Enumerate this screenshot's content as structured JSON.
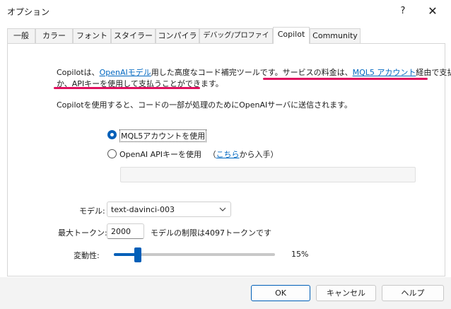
{
  "window": {
    "title": "オプション",
    "help_symbol": "?",
    "close_symbol": "✕"
  },
  "tabs": [
    {
      "label": "一般"
    },
    {
      "label": "カラー"
    },
    {
      "label": "フォント"
    },
    {
      "label": "スタイラー"
    },
    {
      "label": "コンパイラ"
    },
    {
      "label": "デバッグ/プロファイリング"
    },
    {
      "label": "Copilot",
      "active": true
    },
    {
      "label": "Community"
    }
  ],
  "intro": {
    "p1_a": "Copilotは、",
    "p1_link": "OpenAIモデル",
    "p1_b": "用した高度なコード補完ツールです。",
    "p1_c": "サービスの料金は、",
    "p1_link2": "MQL5 アカウント",
    "p1_d": "経由で支払う",
    "p1_line2": "か、APIキーを使用して支払うことができます。",
    "p2": "Copilotを使用すると、コードの一部が処理のためにOpenAIサーバに送信されます。"
  },
  "payment": {
    "option_mql5": "MQL5アカウントを使用",
    "option_api": "OpenAI APIキーを使用",
    "api_hint_open": "（",
    "api_hint_link": "こちら",
    "api_hint_rest": "から入手）",
    "selected": "mql5"
  },
  "model": {
    "label": "モデル:",
    "value": "text-davinci-003"
  },
  "max_tokens": {
    "label": "最大トークン:",
    "value": "2000",
    "note": "モデルの制限は4097トークンです"
  },
  "variability": {
    "label": "変動性:",
    "value_text": "15%",
    "value": 0.15
  },
  "buttons": {
    "ok": "OK",
    "cancel": "キャンセル",
    "help": "ヘルプ"
  },
  "colors": {
    "accent": "#005fb8",
    "highlight": "#e0115f",
    "link": "#0067c0"
  }
}
